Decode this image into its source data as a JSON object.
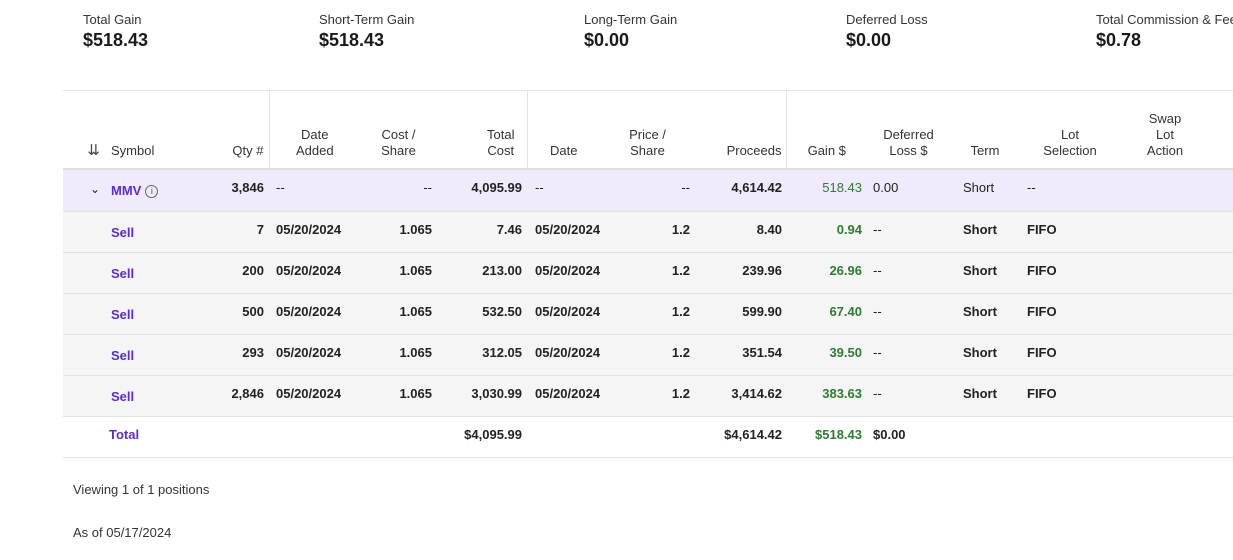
{
  "summary": [
    {
      "label": "Total Gain",
      "value": "$518.43"
    },
    {
      "label": "Short-Term Gain",
      "value": "$518.43"
    },
    {
      "label": "Long-Term Gain",
      "value": "$0.00"
    },
    {
      "label": "Deferred Loss",
      "value": "$0.00"
    },
    {
      "label": "Total Commission & Fees",
      "value": "$0.78"
    }
  ],
  "headers": {
    "symbol": "Symbol",
    "qty": "Qty #",
    "date_added_1": "Date",
    "date_added_2": "Added",
    "cost_1": "Cost /",
    "cost_2": "Share",
    "total_1": "Total",
    "total_2": "Cost",
    "date": "Date",
    "price_1": "Price /",
    "price_2": "Share",
    "proceeds": "Proceeds",
    "gain": "Gain $",
    "def_1": "Deferred",
    "def_2": "Loss $",
    "term": "Term",
    "lot_1": "Lot",
    "lot_2": "Selection",
    "swap_1": "Swap",
    "swap_2": "Lot",
    "swap_3": "Action"
  },
  "group": {
    "symbol": "MMV",
    "qty": "3,846",
    "date_added": "--",
    "cost": "--",
    "total": "4,095.99",
    "date": "--",
    "price": "--",
    "proceeds": "4,614.42",
    "gain": "518.43",
    "deferred": "0.00",
    "term": "Short",
    "lot": "--"
  },
  "lots": [
    {
      "action": "Sell",
      "qty": "7",
      "date_added": "05/20/2024",
      "cost": "1.065",
      "total": "7.46",
      "date": "05/20/2024",
      "price": "1.2",
      "proceeds": "8.40",
      "gain": "0.94",
      "deferred": "--",
      "term": "Short",
      "lot": "FIFO"
    },
    {
      "action": "Sell",
      "qty": "200",
      "date_added": "05/20/2024",
      "cost": "1.065",
      "total": "213.00",
      "date": "05/20/2024",
      "price": "1.2",
      "proceeds": "239.96",
      "gain": "26.96",
      "deferred": "--",
      "term": "Short",
      "lot": "FIFO"
    },
    {
      "action": "Sell",
      "qty": "500",
      "date_added": "05/20/2024",
      "cost": "1.065",
      "total": "532.50",
      "date": "05/20/2024",
      "price": "1.2",
      "proceeds": "599.90",
      "gain": "67.40",
      "deferred": "--",
      "term": "Short",
      "lot": "FIFO"
    },
    {
      "action": "Sell",
      "qty": "293",
      "date_added": "05/20/2024",
      "cost": "1.065",
      "total": "312.05",
      "date": "05/20/2024",
      "price": "1.2",
      "proceeds": "351.54",
      "gain": "39.50",
      "deferred": "--",
      "term": "Short",
      "lot": "FIFO"
    },
    {
      "action": "Sell",
      "qty": "2,846",
      "date_added": "05/20/2024",
      "cost": "1.065",
      "total": "3,030.99",
      "date": "05/20/2024",
      "price": "1.2",
      "proceeds": "3,414.62",
      "gain": "383.63",
      "deferred": "--",
      "term": "Short",
      "lot": "FIFO"
    }
  ],
  "total": {
    "label": "Total",
    "total": "$4,095.99",
    "proceeds": "$4,614.42",
    "gain": "$518.43",
    "deferred": "$0.00"
  },
  "footer": {
    "viewing": "Viewing 1 of 1 positions",
    "as_of": "As of 05/17/2024"
  }
}
